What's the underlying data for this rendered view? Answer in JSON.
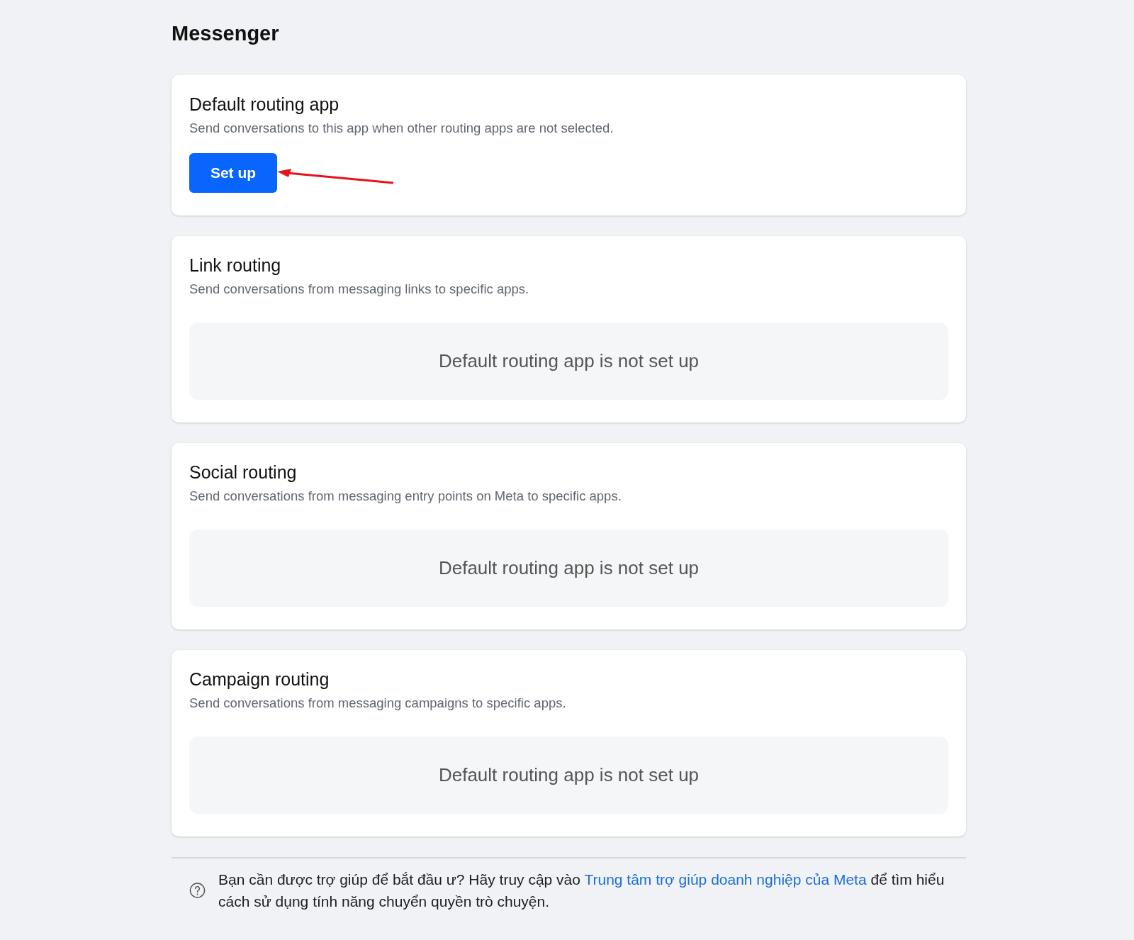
{
  "page": {
    "title": "Messenger"
  },
  "sections": [
    {
      "kind": "button",
      "title": "Default routing app",
      "description": "Send conversations to this app when other routing apps are not selected.",
      "button": "Set up"
    },
    {
      "kind": "empty",
      "title": "Link routing",
      "description": "Send conversations from messaging links to specific apps.",
      "empty_message": "Default routing app is not set up"
    },
    {
      "kind": "empty",
      "title": "Social routing",
      "description": "Send conversations from messaging entry points on Meta to specific apps.",
      "empty_message": "Default routing app is not set up"
    },
    {
      "kind": "empty",
      "title": "Campaign routing",
      "description": "Send conversations from messaging campaigns to specific apps.",
      "empty_message": "Default routing app is not set up"
    }
  ],
  "help": {
    "text_before": "Bạn cần được trợ giúp để bắt đầu ư? Hãy truy cập vào ",
    "link": "Trung tâm trợ giúp doanh nghiệp của Meta",
    "text_after": " để tìm hiểu cách sử dụng tính năng chuyển quyền trò chuyện."
  }
}
